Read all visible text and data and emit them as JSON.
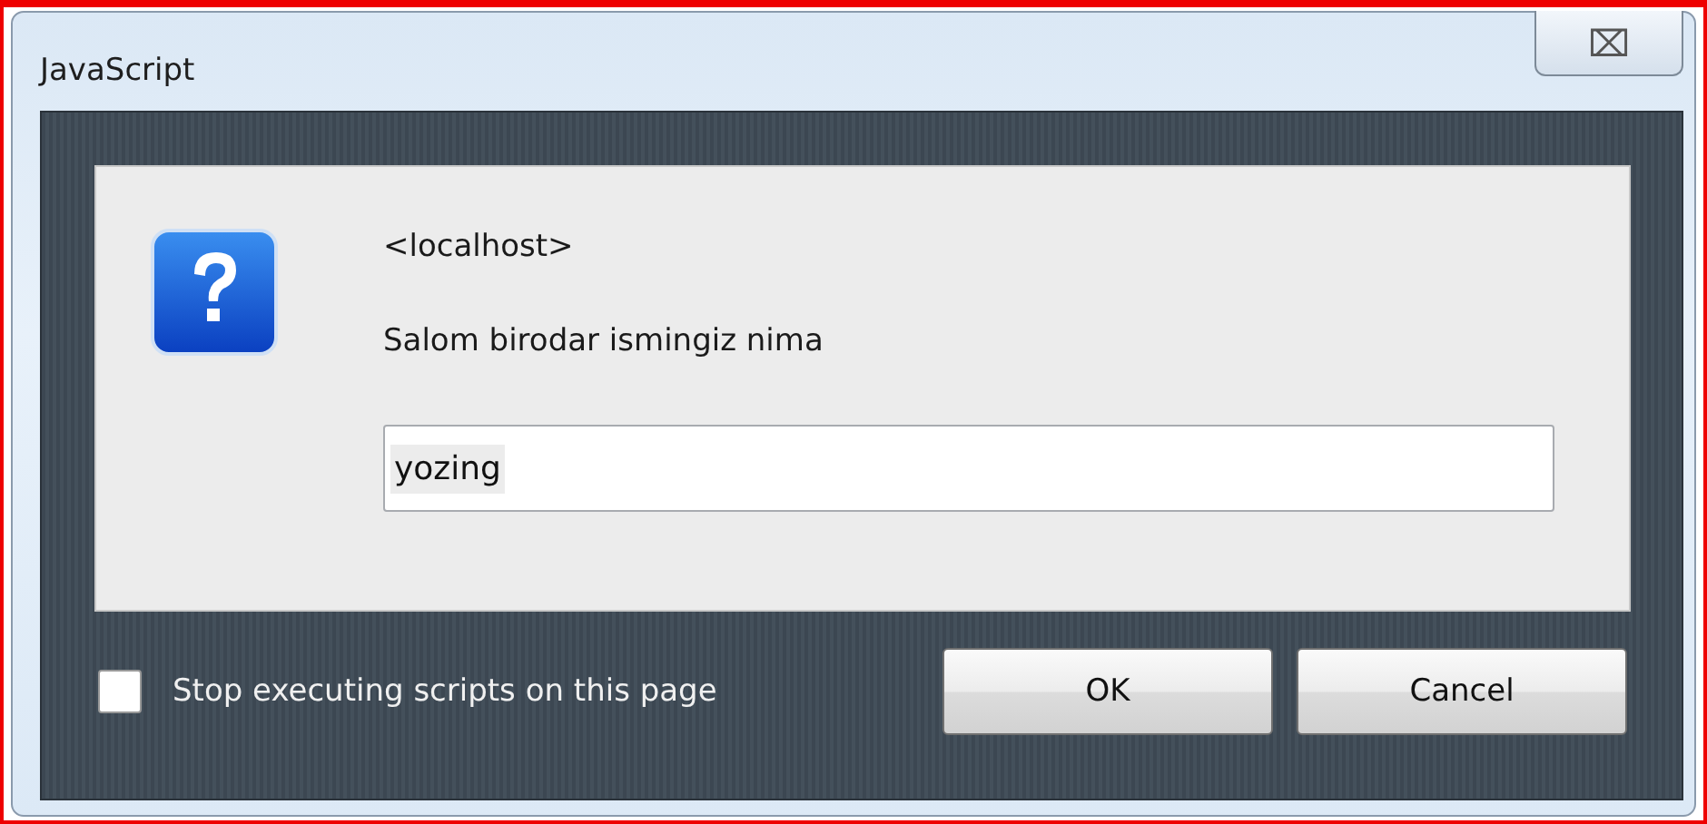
{
  "window": {
    "title": "JavaScript",
    "close_symbol": "⌧"
  },
  "prompt": {
    "origin": "<localhost>",
    "message": "Salom birodar ismingiz nima",
    "input": {
      "value": "yozing"
    }
  },
  "stop_scripts": {
    "label": "Stop executing scripts on this page",
    "checked": false
  },
  "buttons": [
    {
      "label": "OK"
    },
    {
      "label": "Cancel"
    }
  ]
}
